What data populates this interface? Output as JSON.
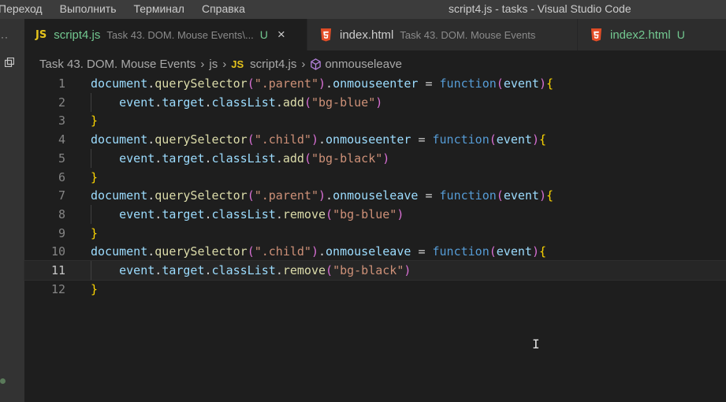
{
  "menu": [
    "Переход",
    "Выполнить",
    "Терминал",
    "Справка"
  ],
  "window_title": "script4.js - tasks - Visual Studio Code",
  "tabs": [
    {
      "badge": "JS",
      "name": "script4.js",
      "desc": "Task 43. DOM. Mouse Events\\...",
      "status": "U",
      "close": "×",
      "active": true
    },
    {
      "badge": "html5-icon",
      "name": "index.html",
      "desc": "Task 43. DOM. Mouse Events",
      "active": false
    },
    {
      "badge": "html5-icon",
      "name": "index2.html",
      "status": "U",
      "active": false
    }
  ],
  "breadcrumb": {
    "folder": "Task 43. DOM. Mouse Events",
    "sub": "js",
    "file_badge": "JS",
    "file": "script4.js",
    "symbol": "onmouseleave"
  },
  "editor": {
    "current_line": 11,
    "lines": [
      {
        "n": "1",
        "text": "document.querySelector(\".parent\").onmouseenter = function(event){"
      },
      {
        "n": "2",
        "text": "    event.target.classList.add(\"bg-blue\")"
      },
      {
        "n": "3",
        "text": "}"
      },
      {
        "n": "4",
        "text": "document.querySelector(\".child\").onmouseenter = function(event){"
      },
      {
        "n": "5",
        "text": "    event.target.classList.add(\"bg-black\")"
      },
      {
        "n": "6",
        "text": "}"
      },
      {
        "n": "7",
        "text": "document.querySelector(\".parent\").onmouseleave = function(event){"
      },
      {
        "n": "8",
        "text": "    event.target.classList.remove(\"bg-blue\")"
      },
      {
        "n": "9",
        "text": "}"
      },
      {
        "n": "10",
        "text": "document.querySelector(\".child\").onmouseleave = function(event){"
      },
      {
        "n": "11",
        "text": "    event.target.classList.remove(\"bg-black\")"
      },
      {
        "n": "12",
        "text": "}"
      }
    ]
  },
  "colors": {
    "js_badge": "#e5c31c",
    "html_badge": "#e44d26",
    "untracked": "#73c991",
    "keyword": "#569cd6",
    "string": "#ce9178",
    "function": "#dcdcaa",
    "variable": "#9cdcfe"
  }
}
